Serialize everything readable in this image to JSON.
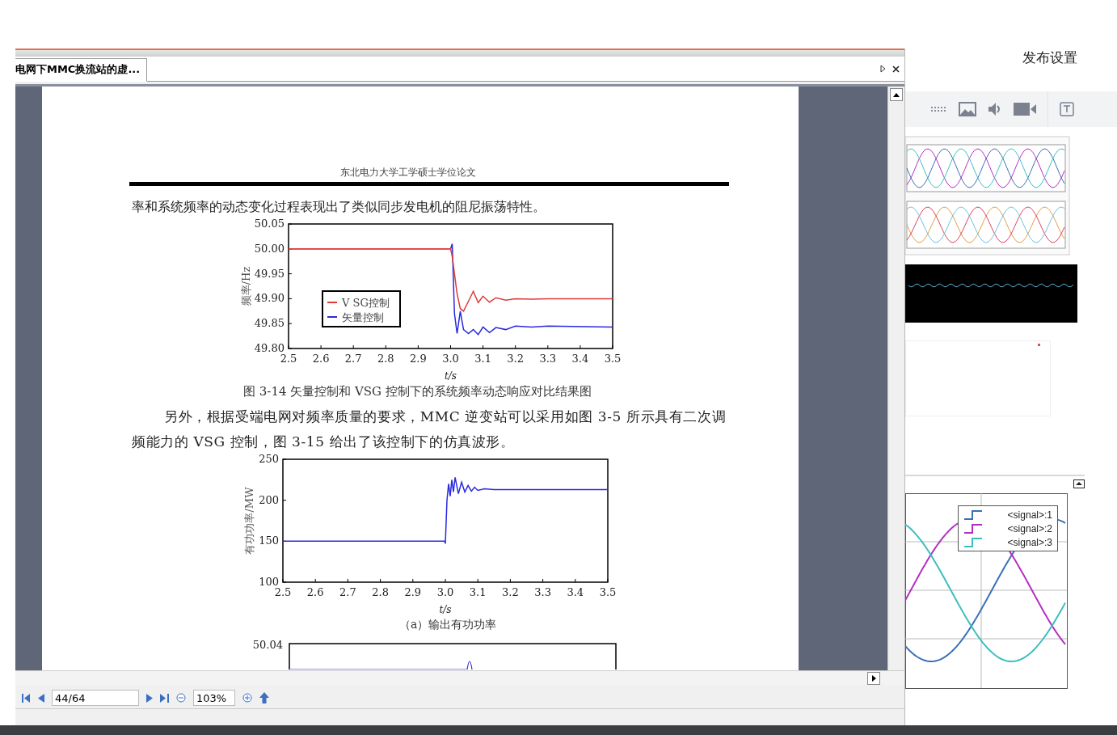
{
  "viewer": {
    "tab": {
      "label": "电网下MMC换流站的虚...",
      "selected": true
    },
    "page": {
      "running_header": "东北电力大学工学硕士学位论文",
      "lead_text": "率和系统频率的动态变化过程表现出了类似同步发电机的阻尼振荡特性。",
      "figure_1": {
        "caption": "图 3-14 矢量控制和 VSG 控制下的系统频率动态响应对比结果图",
        "chart_data": {
          "type": "line",
          "xlabel": "t/s",
          "ylabel": "频率/Hz",
          "x": [
            2.5,
            3.0,
            3.005,
            3.012,
            3.02,
            3.03,
            3.04,
            3.055,
            3.07,
            3.085,
            3.1,
            3.12,
            3.14,
            3.17,
            3.2,
            3.25,
            3.3,
            3.5
          ],
          "series": [
            {
              "name": "V SG控制",
              "color": "#e03a3a",
              "values": [
                50.0,
                50.0,
                49.985,
                49.95,
                49.91,
                49.88,
                49.875,
                49.895,
                49.915,
                49.892,
                49.905,
                49.893,
                49.902,
                49.897,
                49.9,
                49.899,
                49.9,
                49.9
              ]
            },
            {
              "name": "矢量控制",
              "color": "#2a2ae0",
              "values": [
                50.0,
                50.0,
                50.01,
                49.87,
                49.83,
                49.875,
                49.838,
                49.83,
                49.838,
                49.828,
                49.843,
                49.832,
                49.842,
                49.838,
                49.845,
                49.843,
                49.845,
                49.843
              ]
            }
          ],
          "xlim": [
            2.5,
            3.5
          ],
          "ylim": [
            49.8,
            50.05
          ],
          "legend": true,
          "xticks": [
            2.5,
            2.6,
            2.7,
            2.8,
            2.9,
            {
              "value": 3.0,
              "label": "3.0"
            },
            3.1,
            3.2,
            3.3,
            3.4,
            3.5
          ],
          "yticks": [
            {
              "value": 49.8,
              "label": "49.80"
            },
            {
              "value": 49.85,
              "label": "49.85"
            },
            {
              "value": 49.9,
              "label": "49.90"
            },
            {
              "value": 49.95,
              "label": "49.95"
            },
            {
              "value": 50.0,
              "label": "50.00"
            },
            {
              "value": 50.05,
              "label": "50.05"
            }
          ]
        }
      },
      "paragraph": "另外，根据受端电网对频率质量的要求，MMC 逆变站可以采用如图 3-5 所示具有二次调频能力的 VSG 控制，图 3-15 给出了该控制下的仿真波形。",
      "figure_2": {
        "caption": "（a）输出有功功率",
        "chart_data": {
          "type": "line",
          "xlabel": "t/s",
          "ylabel": "有功功率/MW",
          "x": [
            2.5,
            2.998,
            3.0,
            3.005,
            3.01,
            3.015,
            3.02,
            3.025,
            3.03,
            3.04,
            3.05,
            3.06,
            3.07,
            3.08,
            3.09,
            3.1,
            3.12,
            3.15,
            3.5
          ],
          "values": [
            150,
            150,
            147,
            200,
            220,
            205,
            225,
            210,
            228,
            208,
            222,
            210,
            218,
            211,
            216,
            212,
            214,
            213,
            213
          ],
          "xlim": [
            2.5,
            3.5
          ],
          "ylim": [
            100,
            250
          ],
          "xticks": [
            2.5,
            2.6,
            2.7,
            2.8,
            2.9,
            {
              "value": 3.0,
              "label": "3.0"
            },
            3.1,
            3.2,
            3.3,
            3.4,
            3.5
          ],
          "yticks": [
            100,
            150,
            200,
            250
          ]
        }
      },
      "figure_3": {
        "tick_label": "50.04"
      }
    },
    "toolbar": {
      "page_field": "44/64",
      "zoom_field": "103%"
    }
  },
  "side_panel": {
    "title": "发布设置",
    "legend": [
      {
        "label": "<signal>:1",
        "color": "#3a70b8"
      },
      {
        "label": "<signal>:2",
        "color": "#b62fc4"
      },
      {
        "label": "<signal>:3",
        "color": "#3cbfbf"
      }
    ]
  }
}
